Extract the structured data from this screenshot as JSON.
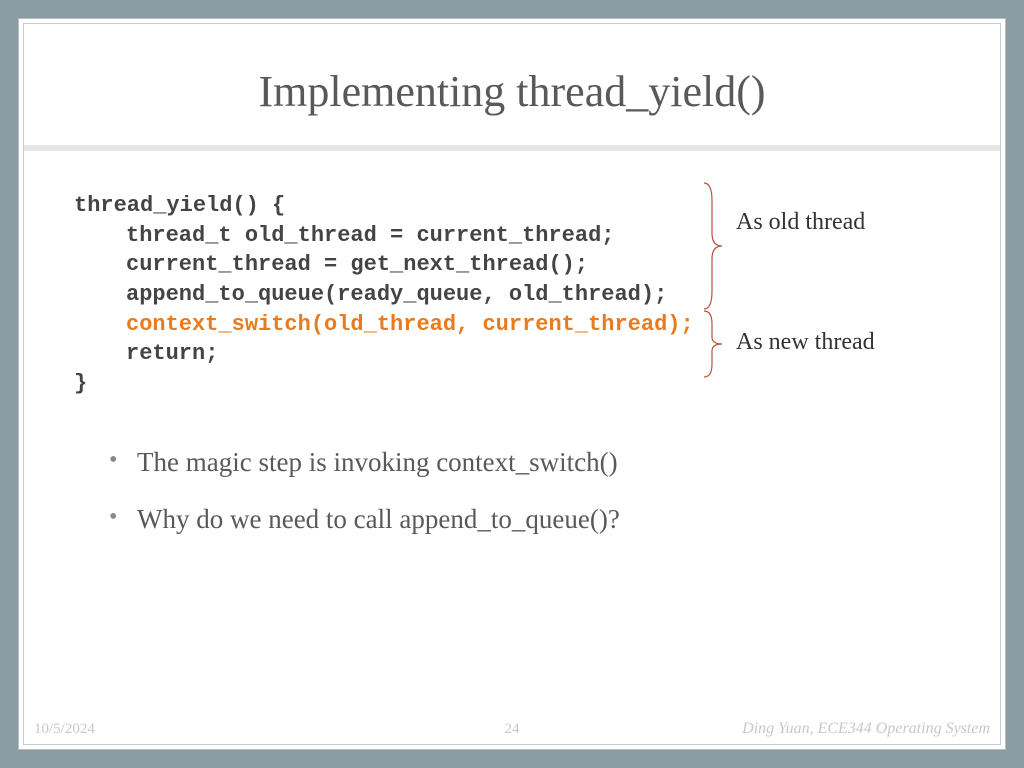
{
  "slide": {
    "title": "Implementing thread_yield()",
    "code": {
      "line1": "thread_yield() {",
      "line2": "thread_t old_thread = current_thread;",
      "line3": "current_thread = get_next_thread();",
      "line4": "append_to_queue(ready_queue, old_thread);",
      "line5": "context_switch(old_thread, current_thread);",
      "line6": "return;",
      "line7": "}"
    },
    "annotations": {
      "label1": "As old thread",
      "label2": "As new thread"
    },
    "bullets": {
      "item1": "The magic step is invoking context_switch()",
      "item2": "Why do we need to call append_to_queue()?"
    },
    "footer": {
      "date": "10/5/2024",
      "page": "24",
      "author": "Ding Yuan, ECE344 Operating System"
    }
  }
}
